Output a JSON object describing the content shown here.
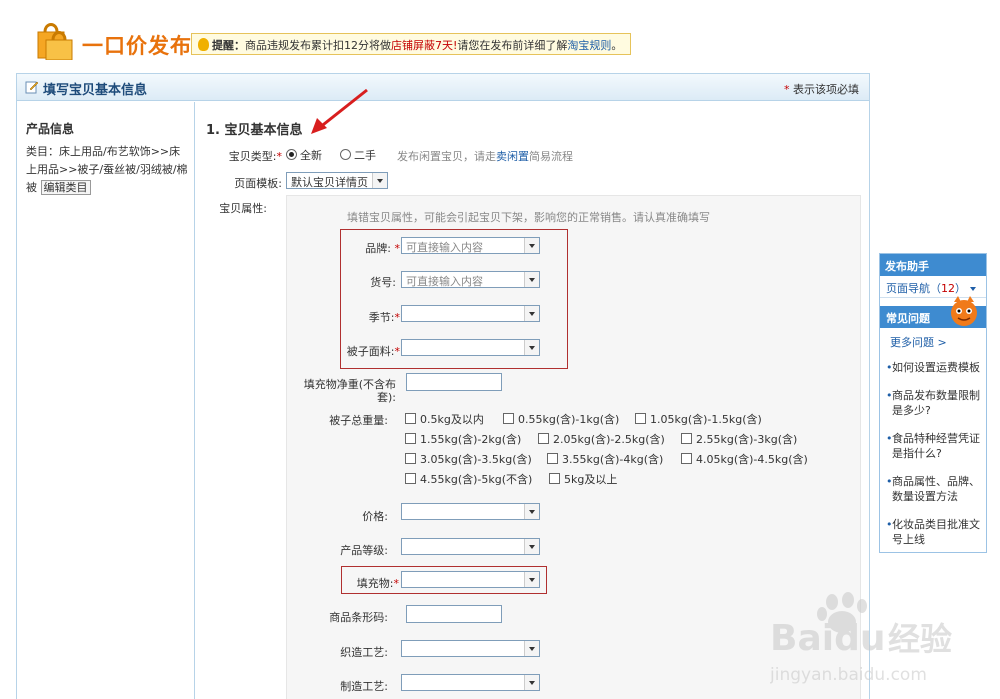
{
  "header": {
    "title": "一口价发布",
    "notice_label": "提醒：",
    "notice_text": "商品违规发布累计扣12分将做",
    "notice_link": "店铺屏蔽7天!",
    "notice_text2": "请您在发布前详细了解",
    "notice_rules": "淘宝规则",
    "notice_end": "。"
  },
  "panel": {
    "title": "填写宝贝基本信息",
    "required_star": "*",
    "required_note": "表示该项必填"
  },
  "left": {
    "title": "产品信息",
    "category_prefix": "类目：",
    "category_path": "床上用品/布艺软饰>>床上用品>>被子/蚕丝被/羽绒被/棉被",
    "edit_button": "编辑类目"
  },
  "form": {
    "section_title": "1. 宝贝基本信息",
    "type_label": "宝贝类型:",
    "type_new": "全新",
    "type_used": "二手",
    "type_hint": "发布闲置宝贝，请走",
    "type_hint_link": "卖闲置",
    "type_hint_end": "简易流程",
    "template_label": "页面模板:",
    "template_value": "默认宝贝详情页",
    "attr_label": "宝贝属性:",
    "attr_hint": "填错宝贝属性，可能会引起宝贝下架，影响您的正常销售。请认真准确填写",
    "brand_label": "品牌:",
    "brand_placeholder": "可直接输入内容",
    "item_no_label": "货号:",
    "item_no_placeholder": "可直接输入内容",
    "season_label": "季节:",
    "fabric_label": "被子面料:",
    "filling_weight_label": "填充物净重(不含布套):",
    "total_weight_label": "被子总重量:",
    "weights": [
      "0.5kg及以内",
      "0.55kg(含)-1kg(含)",
      "1.05kg(含)-1.5kg(含)",
      "1.55kg(含)-2kg(含)",
      "2.05kg(含)-2.5kg(含)",
      "2.55kg(含)-3kg(含)",
      "3.05kg(含)-3.5kg(含)",
      "3.55kg(含)-4kg(含)",
      "4.05kg(含)-4.5kg(含)",
      "4.55kg(含)-5kg(不含)",
      "5kg及以上"
    ],
    "price_label": "价格:",
    "grade_label": "产品等级:",
    "filling_label": "填充物:",
    "barcode_label": "商品条形码:",
    "weave_label": "织造工艺:",
    "make_label": "制造工艺:"
  },
  "helper": {
    "title": "发布助手",
    "nav": "页面导航（",
    "nav_count": "12",
    "nav_end": "）",
    "faq_title": "常见问题",
    "more": "更多问题 >",
    "items": [
      "如何设置运费模板",
      "商品发布数量限制是多少?",
      "食品特种经营凭证是指什么?",
      "商品属性、品牌、数量设置方法",
      "化妆品类目批准文号上线"
    ]
  },
  "watermark": {
    "brand": "Baidu",
    "brand2": "经验",
    "url": "jingyan.baidu.com"
  },
  "colors": {
    "accent": "#e8720c",
    "link": "#1e5ea7",
    "required": "#c40000"
  }
}
